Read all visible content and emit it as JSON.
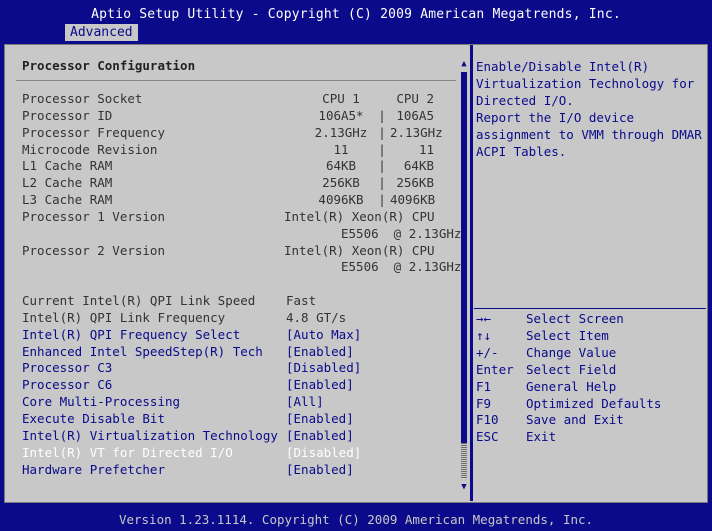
{
  "header": {
    "title": "Aptio Setup Utility - Copyright (C) 2009 American Megatrends, Inc.",
    "active_tab": "Advanced"
  },
  "main": {
    "section_title": "Processor Configuration",
    "info_rows": [
      {
        "label": "Processor Socket",
        "cpu1": "CPU 1",
        "sep": "",
        "cpu2": "CPU 2"
      },
      {
        "label": "Processor ID",
        "cpu1": "106A5*",
        "sep": "|",
        "cpu2": "106A5"
      },
      {
        "label": "Processor Frequency",
        "cpu1": "2.13GHz",
        "sep": "|",
        "cpu2": "2.13GHz"
      },
      {
        "label": "Microcode Revision",
        "cpu1": "11",
        "sep": "|",
        "cpu2": "11"
      },
      {
        "label": "L1 Cache RAM",
        "cpu1": "64KB",
        "sep": "|",
        "cpu2": "64KB"
      },
      {
        "label": "L2 Cache RAM",
        "cpu1": "256KB",
        "sep": "|",
        "cpu2": "256KB"
      },
      {
        "label": "L3 Cache RAM",
        "cpu1": "4096KB",
        "sep": "|",
        "cpu2": "4096KB"
      }
    ],
    "version_rows": [
      {
        "label": "Processor 1 Version",
        "line1": "Intel(R) Xeon(R) CPU",
        "line2": "E5506  @ 2.13GHz"
      },
      {
        "label": "Processor 2 Version",
        "line1": "Intel(R) Xeon(R) CPU",
        "line2": "E5506  @ 2.13GHz"
      }
    ],
    "status_rows": [
      {
        "label": "Current Intel(R) QPI Link Speed",
        "value": "Fast"
      },
      {
        "label": "Intel(R) QPI Link Frequency",
        "value": "4.8 GT/s"
      }
    ],
    "settings": [
      {
        "label": "Intel(R) QPI Frequency Select",
        "value": "[Auto Max]"
      },
      {
        "label": "Enhanced Intel SpeedStep(R) Tech",
        "value": "[Enabled]"
      },
      {
        "label": "Processor C3",
        "value": "[Disabled]"
      },
      {
        "label": "Processor C6",
        "value": "[Enabled]"
      },
      {
        "label": "Core Multi-Processing",
        "value": "[All]"
      },
      {
        "label": "Execute Disable Bit",
        "value": "[Enabled]"
      },
      {
        "label": "Intel(R) Virtualization Technology",
        "value": "[Enabled]"
      },
      {
        "label": "Intel(R) VT for Directed I/O",
        "value": "[Disabled]",
        "selected": true
      },
      {
        "label": "Hardware Prefetcher",
        "value": "[Enabled]"
      }
    ]
  },
  "help": {
    "text": "Enable/Disable Intel(R)\nVirtualization Technology for\nDirected I/O.\nReport the I/O device\nassignment to VMM through DMAR\nACPI Tables.",
    "keys": [
      {
        "key": "→←",
        "action": "Select Screen"
      },
      {
        "key": "↑↓",
        "action": "Select Item"
      },
      {
        "key": "+/-",
        "action": "Change Value"
      },
      {
        "key": "Enter",
        "action": "Select Field"
      },
      {
        "key": "F1",
        "action": "General Help"
      },
      {
        "key": "F9",
        "action": "Optimized Defaults"
      },
      {
        "key": "F10",
        "action": "Save and Exit"
      },
      {
        "key": "ESC",
        "action": "Exit"
      }
    ]
  },
  "footer": {
    "text": "Version 1.23.1114. Copyright (C) 2009 American Megatrends, Inc."
  },
  "colors": {
    "background": "#0a0a8a",
    "panel": "#c8c8c8",
    "setting_text": "#0a0a8a",
    "info_text": "#333333",
    "highlight": "#ffffff"
  },
  "icons": {
    "scroll_up": "scroll-up-arrow-icon",
    "scroll_down": "scroll-down-arrow-icon"
  }
}
